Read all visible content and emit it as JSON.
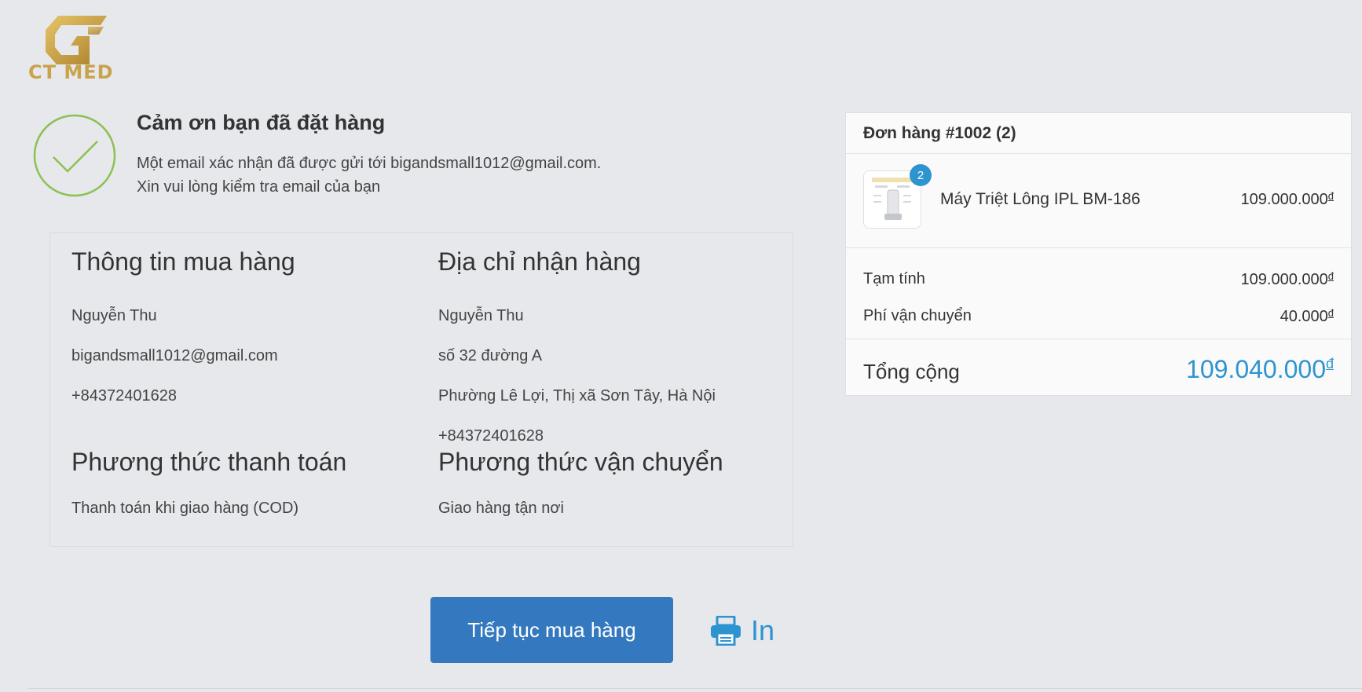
{
  "brand": {
    "logo_text": "CT MED",
    "logo_color": "#c9a24a"
  },
  "confirmation": {
    "icon": "checkmark-circle-icon",
    "title": "Cảm ơn bạn đã đặt hàng",
    "line1": "Một email xác nhận đã được gửi tới bigandsmall1012@gmail.com.",
    "line2": "Xin vui lòng kiểm tra email của bạn"
  },
  "customer_info": {
    "title": "Thông tin mua hàng",
    "name": "Nguyễn Thu",
    "email": "bigandsmall1012@gmail.com",
    "phone": "+84372401628"
  },
  "shipping_address": {
    "title": "Địa chỉ nhận hàng",
    "name": "Nguyễn Thu",
    "street": "số 32 đường A",
    "area": "Phường Lê Lợi, Thị xã Sơn Tây, Hà Nội",
    "phone": "+84372401628"
  },
  "payment_method": {
    "title": "Phương thức thanh toán",
    "value": "Thanh toán khi giao hàng (COD)"
  },
  "shipping_method": {
    "title": "Phương thức vận chuyển",
    "value": "Giao hàng tận nơi"
  },
  "actions": {
    "continue_label": "Tiếp tục mua hàng",
    "print_label": "In",
    "print_icon": "printer-icon",
    "button_color": "#3479bf",
    "link_color": "#2e94d0"
  },
  "order": {
    "header": "Đơn hàng #1002 (2)",
    "items": [
      {
        "name": "Máy Triệt Lông IPL BM-186",
        "quantity": "2",
        "price": "109.000.000"
      }
    ],
    "currency_symbol": "đ",
    "subtotal_label": "Tạm tính",
    "subtotal_value": "109.000.000",
    "shipping_label": "Phí vận chuyển",
    "shipping_value": "40.000",
    "total_label": "Tổng cộng",
    "total_value": "109.040.000",
    "total_color": "#2e94d0"
  }
}
